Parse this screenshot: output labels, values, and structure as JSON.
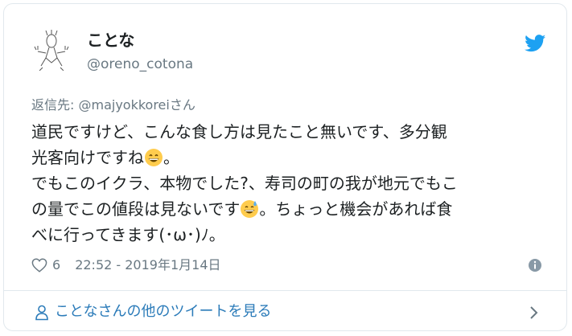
{
  "tweet": {
    "author_name": "ことな",
    "author_handle": "@oreno_cotona",
    "reply_prefix": "返信先: ",
    "reply_handle": "@majyokkorei",
    "reply_suffix": "さん",
    "line1": "道民ですけど、こんな食し方は見たこと無いです、多分観",
    "line2": "光客向けですね",
    "line2_after": "。",
    "line3": "でもこのイクラ、本物でした?、寿司の町の我が地元でもこ",
    "line4": "の量でこの値段は見ないです",
    "line4_after": "。ちょっと機会があれば食",
    "line5": "べに行ってきます(･ω･)ﾉ。",
    "likes": "6",
    "timestamp": "22:52 - 2019年1月14日"
  },
  "footer": {
    "label": "ことなさんの他のツイートを見る"
  },
  "icons": {
    "bird": "twitter-bird-icon",
    "heart": "heart-icon",
    "info": "info-icon",
    "person": "person-icon",
    "chevron": "chevron-right-icon",
    "grin_emoji": "grinning-face-emoji",
    "sweat_emoji": "grinning-sweat-emoji"
  },
  "colors": {
    "twitter_blue": "#1da1f2",
    "link_blue": "#2b7bb9",
    "secondary_text": "#697882",
    "border": "#e1e8ed"
  }
}
